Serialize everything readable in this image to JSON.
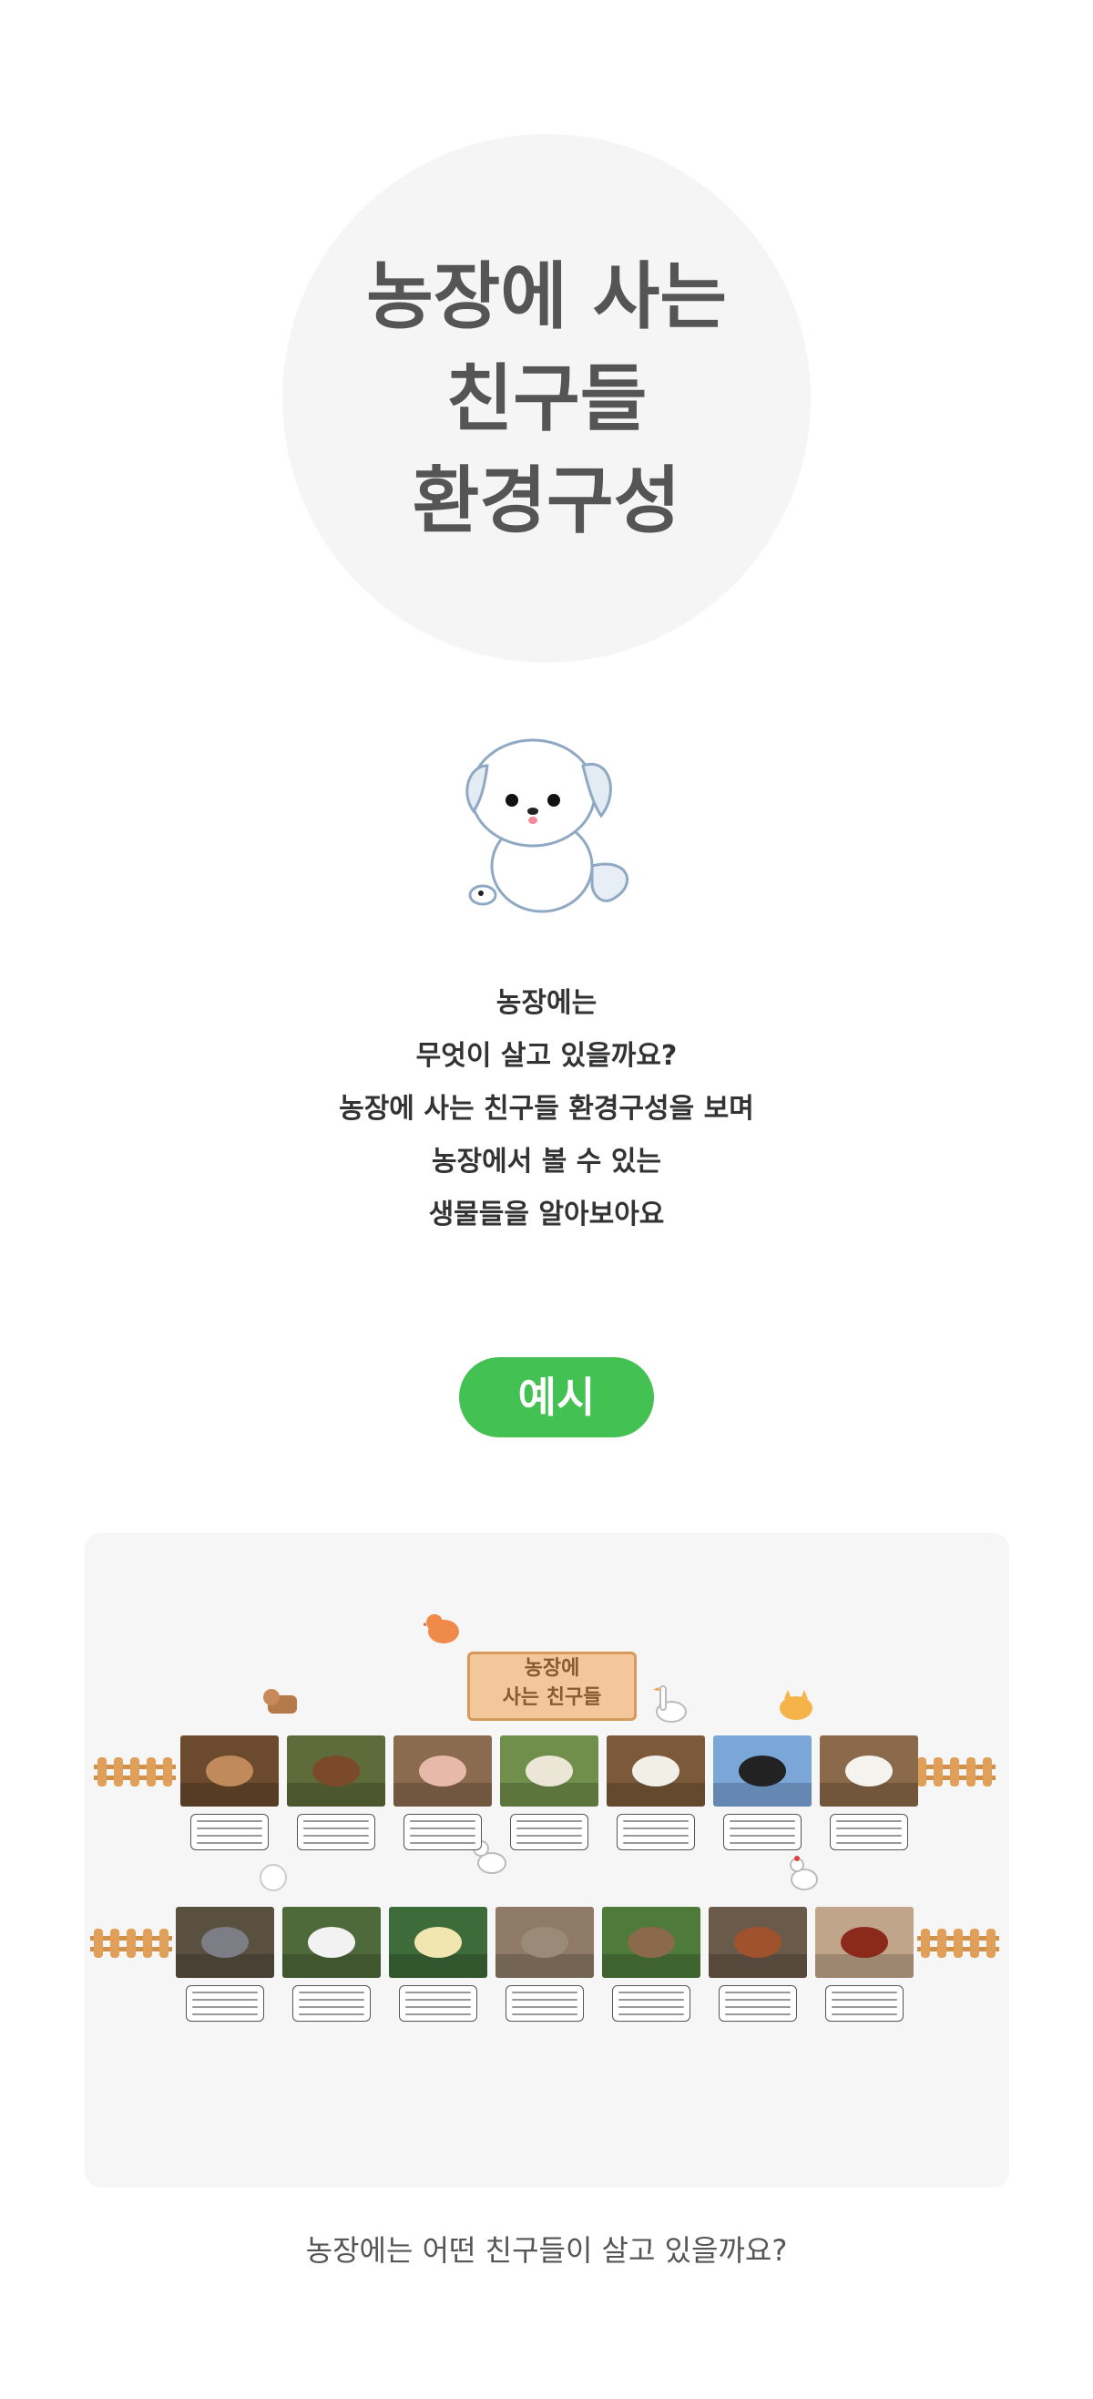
{
  "hero": {
    "title_lines": [
      "농장에 사는",
      "친구들",
      "환경구성"
    ]
  },
  "intro": {
    "lines": [
      "농장에는",
      "무엇이 살고 있을까요?",
      "농장에 사는 친구들 환경구성을 보며",
      "농장에서 볼 수 있는",
      "생물들을 알아보아요"
    ]
  },
  "example": {
    "label": "예시"
  },
  "sign": {
    "line1": "농장에",
    "line2": "사는 친구들"
  },
  "row1": [
    {
      "icon": "rabbit-photo",
      "color": "#c08a5a",
      "bg": "#6b4a2e"
    },
    {
      "icon": "horse-photo",
      "color": "#7a4a2a",
      "bg": "#5e6b3a"
    },
    {
      "icon": "pig-photo",
      "color": "#e7b9a8",
      "bg": "#8b6b4f"
    },
    {
      "icon": "sheep-photo",
      "color": "#ece6d6",
      "bg": "#6f8f4a"
    },
    {
      "icon": "puppy-photo",
      "color": "#f2efe8",
      "bg": "#7a5a3a"
    },
    {
      "icon": "cow-photo",
      "color": "#222222",
      "bg": "#7aa7d8"
    },
    {
      "icon": "goat-photo",
      "color": "#f5f3ee",
      "bg": "#8a6a4a"
    }
  ],
  "row2": [
    {
      "icon": "pigeon-photo",
      "color": "#7d7d85",
      "bg": "#5a5040"
    },
    {
      "icon": "goose-photo",
      "color": "#f2f2f2",
      "bg": "#4e6a3a"
    },
    {
      "icon": "duck-photo",
      "color": "#f2e6b0",
      "bg": "#3d6b3a"
    },
    {
      "icon": "cat-photo",
      "color": "#9a8a78",
      "bg": "#8e7a66"
    },
    {
      "icon": "sparrow-photo",
      "color": "#8a6a4a",
      "bg": "#4e7a3a"
    },
    {
      "icon": "calf-photo",
      "color": "#a0522d",
      "bg": "#6a5a4a"
    },
    {
      "icon": "rooster-photo",
      "color": "#8b2a1a",
      "bg": "#c0a58a"
    }
  ],
  "caption": "농장에는 어떤 친구들이 살고 있을까요?"
}
